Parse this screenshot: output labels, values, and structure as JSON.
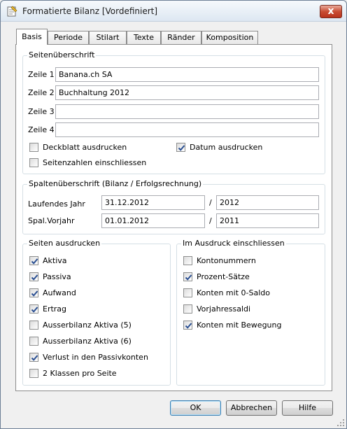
{
  "window": {
    "title": "Formatierte Bilanz [Vordefiniert]",
    "close_glyph": "x"
  },
  "tabs": [
    {
      "label": "Basis",
      "active": true
    },
    {
      "label": "Periode"
    },
    {
      "label": "Stilart"
    },
    {
      "label": "Texte"
    },
    {
      "label": "Ränder"
    },
    {
      "label": "Komposition"
    }
  ],
  "header_group": {
    "title": "Seitenüberschrift",
    "rows": [
      {
        "label": "Zeile 1",
        "value": "Banana.ch SA"
      },
      {
        "label": "Zeile 2",
        "value": "Buchhaltung 2012"
      },
      {
        "label": "Zeile 3",
        "value": ""
      },
      {
        "label": "Zeile 4",
        "value": ""
      }
    ],
    "checkboxes": [
      {
        "label": "Deckblatt ausdrucken",
        "checked": false
      },
      {
        "label": "Datum ausdrucken",
        "checked": true
      },
      {
        "label": "Seitenzahlen einschliessen",
        "checked": false
      }
    ]
  },
  "column_group": {
    "title": "Spaltenüberschrift (Bilanz / Erfolgsrechnung)",
    "rows": [
      {
        "label": "Laufendes Jahr",
        "value1": "31.12.2012",
        "value2": "2012"
      },
      {
        "label": "Spal.Vorjahr",
        "value1": "01.01.2012",
        "value2": "2011"
      }
    ],
    "separator": "/"
  },
  "print_pages": {
    "title": "Seiten ausdrucken",
    "items": [
      {
        "label": "Aktiva",
        "checked": true
      },
      {
        "label": "Passiva",
        "checked": true
      },
      {
        "label": "Aufwand",
        "checked": true
      },
      {
        "label": "Ertrag",
        "checked": true
      },
      {
        "label": "Ausserbilanz Aktiva (5)",
        "checked": false
      },
      {
        "label": "Ausserbilanz Aktiva (6)",
        "checked": false
      },
      {
        "label": "Verlust in den Passivkonten",
        "checked": true
      },
      {
        "label": "2 Klassen pro Seite",
        "checked": false
      }
    ]
  },
  "include": {
    "title": "Im Ausdruck einschliessen",
    "items": [
      {
        "label": "Kontonummern",
        "checked": false
      },
      {
        "label": "Prozent-Sätze",
        "checked": true
      },
      {
        "label": "Konten mit 0-Saldo",
        "checked": false
      },
      {
        "label": "Vorjahressaldi",
        "checked": false
      },
      {
        "label": "Konten mit Bewegung",
        "checked": true
      }
    ]
  },
  "buttons": {
    "ok": "OK",
    "cancel": "Abbrechen",
    "help": "Hilfe"
  }
}
